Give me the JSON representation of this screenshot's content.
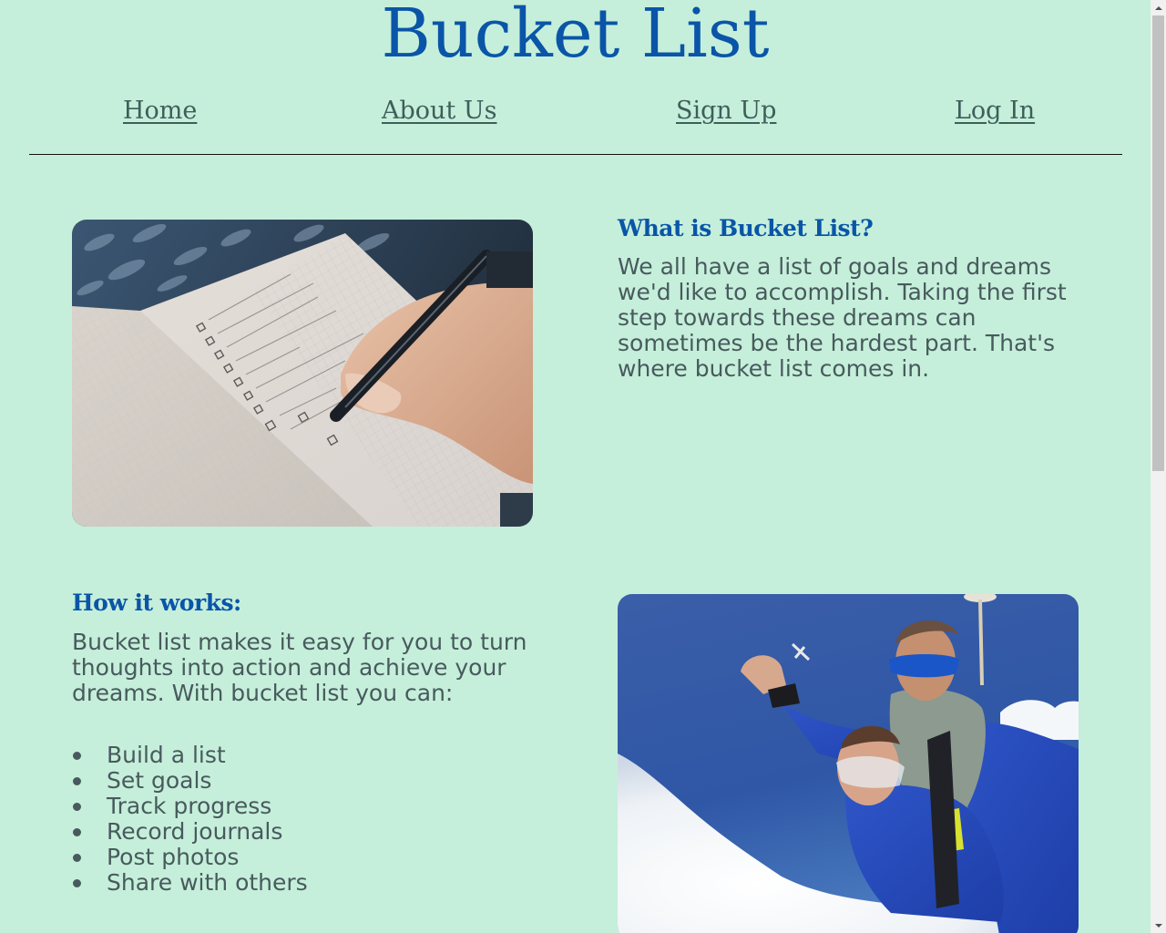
{
  "header": {
    "title": "Bucket List"
  },
  "nav": {
    "items": [
      {
        "label": "Home"
      },
      {
        "label": "About Us"
      },
      {
        "label": "Sign Up"
      },
      {
        "label": "Log In"
      }
    ]
  },
  "about": {
    "heading": "What is Bucket List?",
    "text": "We all have a list of goals and dreams we'd like to accomplish. Taking the first step towards these dreams can sometimes be the hardest part. That's where bucket list comes in.",
    "image_alt": "Hand writing a checklist in a notebook"
  },
  "how": {
    "heading": "How it works:",
    "text": "Bucket list makes it easy for you to turn thoughts into action and achieve your dreams. With bucket list you can:",
    "features": [
      "Build a list",
      "Set goals",
      "Track progress",
      "Record journals",
      "Post photos",
      "Share with others"
    ],
    "image_alt": "Tandem skydivers smiling in the sky above clouds"
  },
  "colors": {
    "background": "#c5efda",
    "title": "#0a55a8",
    "nav_link": "#3f5e5b",
    "body_text": "#485a5e"
  }
}
